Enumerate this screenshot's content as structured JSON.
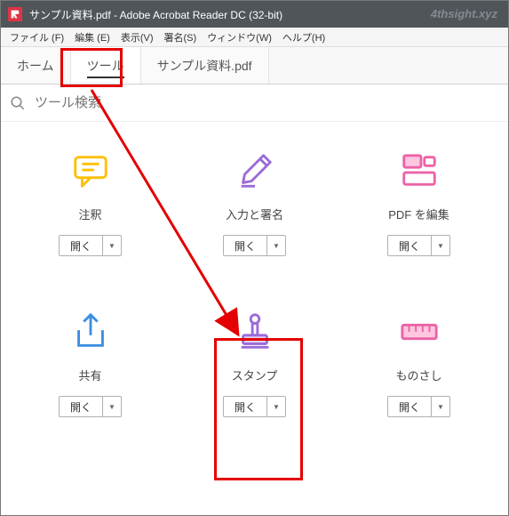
{
  "title_bar": {
    "title": "サンプル資料.pdf - Adobe Acrobat Reader DC (32-bit)"
  },
  "watermark": "4thsight.xyz",
  "menu": {
    "file": "ファイル (F)",
    "edit": "編集 (E)",
    "view": "表示(V)",
    "sign": "署名(S)",
    "window": "ウィンドウ(W)",
    "help": "ヘルプ(H)"
  },
  "tabs": {
    "home": "ホーム",
    "tools": "ツール",
    "doc": "サンプル資料.pdf"
  },
  "search": {
    "placeholder": "ツール検索"
  },
  "tools": {
    "comment": {
      "label": "注釈",
      "open": "開く"
    },
    "fillsign": {
      "label": "入力と署名",
      "open": "開く"
    },
    "editpdf": {
      "label": "PDF を編集",
      "open": "開く"
    },
    "share": {
      "label": "共有",
      "open": "開く"
    },
    "stamp": {
      "label": "スタンプ",
      "open": "開く"
    },
    "measure": {
      "label": "ものさし",
      "open": "開く"
    }
  }
}
